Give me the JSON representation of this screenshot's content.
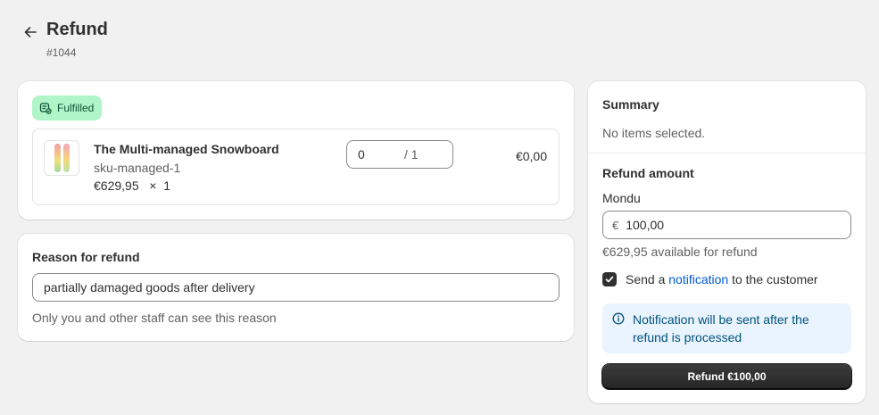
{
  "header": {
    "title": "Refund",
    "order_number": "#1044"
  },
  "fulfillment": {
    "badge": "Fulfilled",
    "item": {
      "name": "The Multi-managed Snowboard",
      "sku": "sku-managed-1",
      "unit_price": "€629,95",
      "times": "×",
      "ordered_qty": "1",
      "refund_qty": "0",
      "qty_max": "/ 1",
      "line_total": "€0,00"
    }
  },
  "reason": {
    "label": "Reason for refund",
    "value": "partially damaged goods after delivery",
    "help": "Only you and other staff can see this reason"
  },
  "summary": {
    "title": "Summary",
    "empty_text": "No items selected.",
    "refund_amount_title": "Refund amount",
    "method": "Mondu",
    "currency_symbol": "€",
    "amount": "100,00",
    "available": "€629,95 available for refund",
    "notify_prefix": "Send a",
    "notify_link": "notification",
    "notify_suffix": "to the customer",
    "notify_checked": true,
    "banner_text": "Notification will be sent after the refund is processed",
    "refund_button": "Refund €100,00"
  },
  "colors": {
    "badge_bg": "#aff5c8",
    "link": "#005bd3",
    "banner_bg": "#eaf4ff",
    "primary": "#303030"
  },
  "icons": [
    "arrow-left-icon",
    "fulfilled-package-icon",
    "checkmark-icon",
    "info-icon"
  ]
}
